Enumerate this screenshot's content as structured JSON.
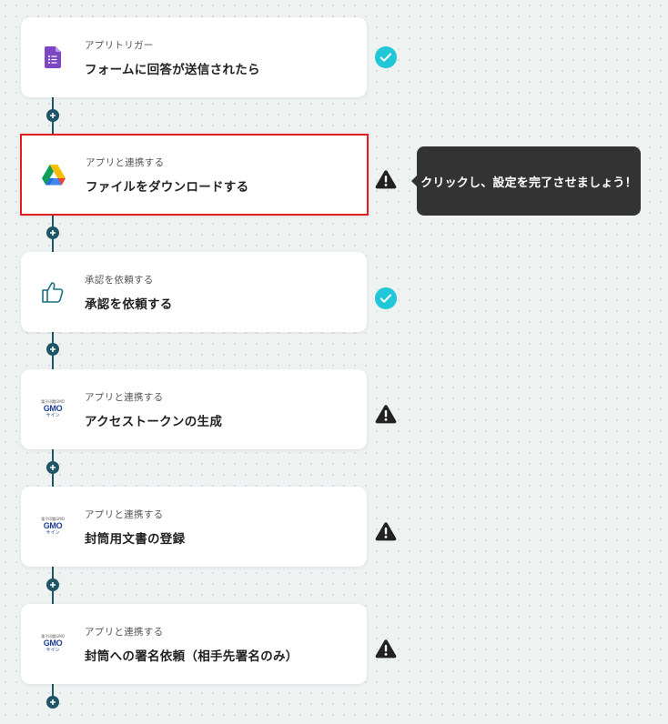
{
  "steps": [
    {
      "subtitle": "アプリトリガー",
      "title": "フォームに回答が送信されたら",
      "icon": "google-forms-icon",
      "status": "complete"
    },
    {
      "subtitle": "アプリと連携する",
      "title": "ファイルをダウンロードする",
      "icon": "google-drive-icon",
      "status": "warning"
    },
    {
      "subtitle": "承認を依頼する",
      "title": "承認を依頼する",
      "icon": "thumbs-up-icon",
      "status": "complete"
    },
    {
      "subtitle": "アプリと連携する",
      "title": "アクセストークンの生成",
      "icon": "gmo-sign-icon",
      "status": "warning"
    },
    {
      "subtitle": "アプリと連携する",
      "title": "封筒用文書の登録",
      "icon": "gmo-sign-icon",
      "status": "warning"
    },
    {
      "subtitle": "アプリと連携する",
      "title": "封筒への署名依頼（相手先署名のみ）",
      "icon": "gmo-sign-icon",
      "status": "warning"
    }
  ],
  "gmo_logo": {
    "line1": "電子印鑑GMO",
    "line2": "GMO",
    "line3": "サイン"
  },
  "tooltip": {
    "text": "クリックし、設定を完了させましょう！"
  },
  "colors": {
    "complete": "#1fc7d8",
    "warning": "#222222",
    "connector": "#1f5566",
    "selected_border": "#e11d1d"
  }
}
